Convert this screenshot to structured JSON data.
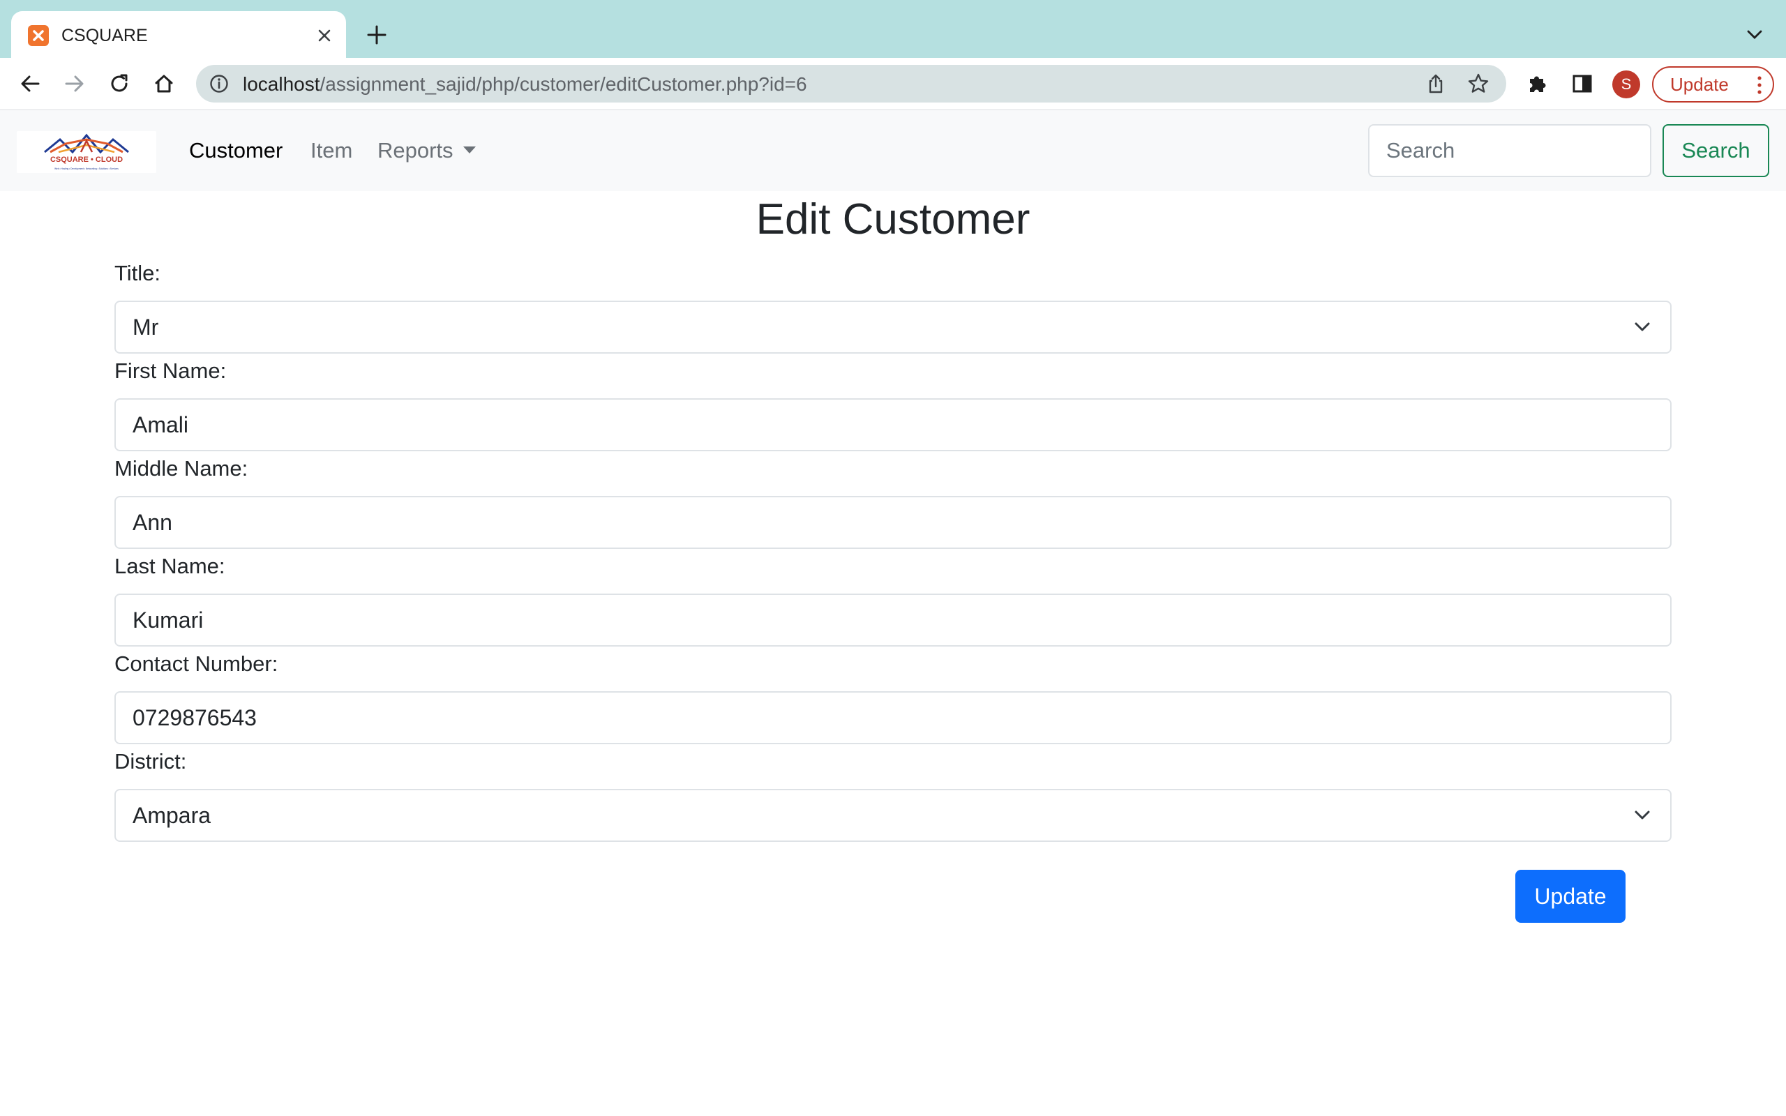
{
  "browser": {
    "tab_title": "CSQUARE",
    "url_host": "localhost",
    "url_path": "/assignment_sajid/php/customer/editCustomer.php?id=6",
    "profile_initial": "S",
    "update_label": "Update"
  },
  "navbar": {
    "brand_text": "CSQUARE • CLOUD",
    "brand_tagline": "Web • Hosting • Development • Networking • Solutions • Services",
    "links": [
      {
        "label": "Customer",
        "active": true
      },
      {
        "label": "Item",
        "active": false
      },
      {
        "label": "Reports",
        "active": false
      }
    ],
    "search_placeholder": "Search",
    "search_button": "Search"
  },
  "form": {
    "title": "Edit Customer",
    "fields": {
      "title": {
        "label": "Title:",
        "value": "Mr"
      },
      "first_name": {
        "label": "First Name:",
        "value": "Amali"
      },
      "middle_name": {
        "label": "Middle Name:",
        "value": "Ann"
      },
      "last_name": {
        "label": "Last Name:",
        "value": "Kumari"
      },
      "contact": {
        "label": "Contact Number:",
        "value": "0729876543"
      },
      "district": {
        "label": "District:",
        "value": "Ampara"
      }
    },
    "submit_label": "Update"
  },
  "colors": {
    "tabstrip": "#b5e0e0",
    "primary": "#0d6efd",
    "success": "#198754",
    "profile": "#c0392b"
  }
}
